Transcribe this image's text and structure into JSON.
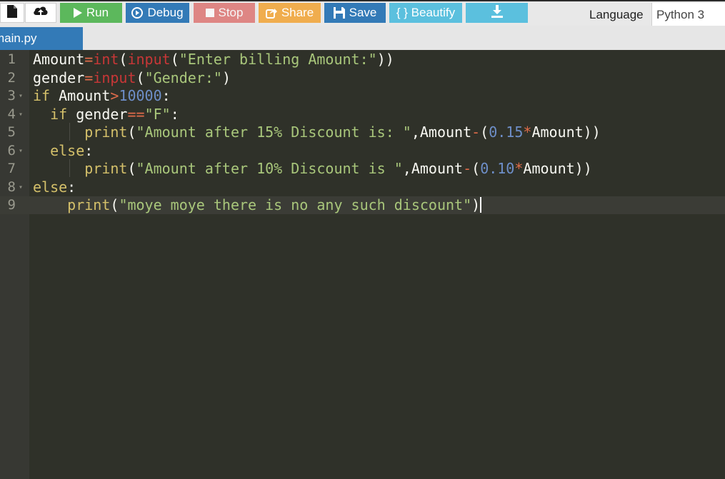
{
  "toolbar": {
    "new_icon": "file-icon",
    "upload_icon": "cloud-upload-icon",
    "run_label": "Run",
    "debug_label": "Debug",
    "stop_label": "Stop",
    "share_label": "Share",
    "save_label": "Save",
    "beautify_label": "{ } Beautify",
    "download_icon": "download-icon",
    "language_label": "Language",
    "language_value": "Python 3"
  },
  "tabs": [
    {
      "label": "main.py"
    }
  ],
  "editor": {
    "line_numbers": [
      "1",
      "2",
      "3",
      "4",
      "5",
      "6",
      "7",
      "8",
      "9"
    ],
    "lines": [
      "Amount=int(input(\"Enter billing Amount:\"))",
      "gender=input(\"Gender:\")",
      "if Amount>10000:",
      "  if gender==\"F\":",
      "      print(\"Amount after 15% Discount is: \",Amount-(0.15*Amount))",
      "  else:",
      "      print(\"Amount after 10% Discount is \",Amount-(0.10*Amount))",
      "else:",
      "    print(\"moye moye there is no any such discount\")"
    ]
  },
  "colors": {
    "run": "#5cb85c",
    "debug": "#337ab7",
    "stop": "#d9534f",
    "share": "#f0ad4e",
    "save": "#337ab7",
    "beautify": "#5bc0de",
    "editor_bg": "#2f3129"
  }
}
